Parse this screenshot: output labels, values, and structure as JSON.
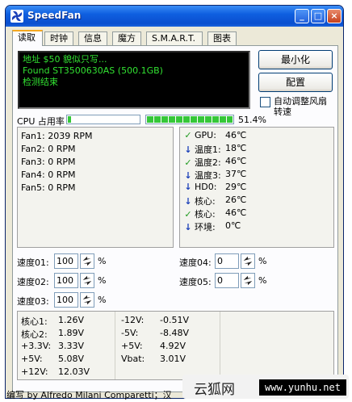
{
  "app": {
    "title": "SpeedFan"
  },
  "tabs": [
    {
      "label": "读取",
      "active": true
    },
    {
      "label": "时钟",
      "active": false
    },
    {
      "label": "信息",
      "active": false
    },
    {
      "label": "魔方",
      "active": false
    },
    {
      "label": "S.M.A.R.T.",
      "active": false
    },
    {
      "label": "图表",
      "active": false
    }
  ],
  "log": [
    "地址 $50 貌似只写...",
    "Found ST3500630AS (500.1GB)",
    "检测结束"
  ],
  "buttons": {
    "minimize": "最小化",
    "config": "配置"
  },
  "auto_fan": {
    "label_line1": "自动调整风扇",
    "label_line2": "转速",
    "checked": false
  },
  "cpu": {
    "label": "CPU 占用率",
    "value_text": "51.4%",
    "bar_small": 0.05,
    "bar_main": 1.0
  },
  "fans": [
    "Fan1: 2039 RPM",
    "Fan2: 0 RPM",
    "Fan3: 0 RPM",
    "Fan4: 0 RPM",
    "Fan5: 0 RPM"
  ],
  "temps": [
    {
      "label": "GPU:",
      "value": "46℃",
      "icon": "check-icon"
    },
    {
      "label": "温度1:",
      "value": "18℃",
      "icon": "arrow-down-icon"
    },
    {
      "label": "温度2:",
      "value": "46℃",
      "icon": "check-icon"
    },
    {
      "label": "温度3:",
      "value": "37℃",
      "icon": "arrow-down-icon"
    },
    {
      "label": "HD0:",
      "value": "29℃",
      "icon": "arrow-down-icon"
    },
    {
      "label": "核心:",
      "value": "26℃",
      "icon": "arrow-down-icon"
    },
    {
      "label": "核心:",
      "value": "46℃",
      "icon": "check-icon"
    },
    {
      "label": "环境:",
      "value": "0℃",
      "icon": "arrow-down-icon"
    }
  ],
  "speeds": [
    {
      "label": "速度01:",
      "value": "100",
      "unit": "%"
    },
    {
      "label": "速度02:",
      "value": "100",
      "unit": "%"
    },
    {
      "label": "速度03:",
      "value": "100",
      "unit": "%"
    },
    {
      "label": "速度04:",
      "value": "0",
      "unit": "%"
    },
    {
      "label": "速度05:",
      "value": "0",
      "unit": "%"
    }
  ],
  "voltages": [
    {
      "label": "核心1:",
      "value": "1.26V"
    },
    {
      "label": "核心2:",
      "value": "1.89V"
    },
    {
      "label": "+3.3V:",
      "value": "3.33V"
    },
    {
      "label": "+5V:",
      "value": "5.08V"
    },
    {
      "label": "+12V:",
      "value": "12.03V"
    },
    {
      "label": "-12V:",
      "value": "-0.51V"
    },
    {
      "label": "-5V:",
      "value": "-8.48V"
    },
    {
      "label": "+5V:",
      "value": "4.92V"
    },
    {
      "label": "Vbat:",
      "value": "3.01V"
    }
  ],
  "status": "编写 by Alfredo Milani Comparetti；汉",
  "watermark": {
    "cn": "云狐网",
    "url": "www.yunhu.net"
  },
  "colors": {
    "log_text": "#32e232",
    "titlebar": "#0a4fcf",
    "bar": "#35c739"
  }
}
